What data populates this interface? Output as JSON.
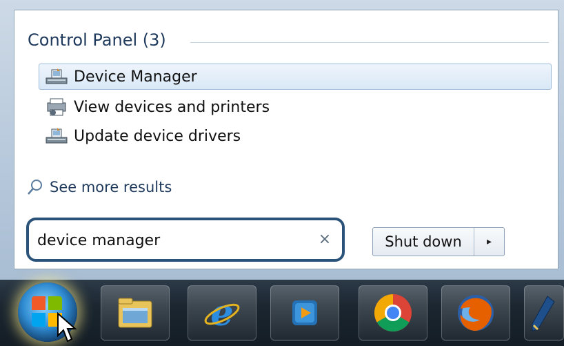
{
  "start_menu": {
    "section_title": "Control Panel (3)",
    "results": [
      {
        "label": "Device Manager",
        "icon": "device-manager-icon",
        "selected": true
      },
      {
        "label": "View devices and printers",
        "icon": "devices-printers-icon",
        "selected": false
      },
      {
        "label": "Update device drivers",
        "icon": "device-manager-icon",
        "selected": false
      }
    ],
    "see_more": "See more results",
    "search": {
      "value": "device manager",
      "clear_glyph": "×"
    },
    "shutdown": {
      "label": "Shut down",
      "arrow_glyph": "▸"
    }
  },
  "taskbar": {
    "items": [
      {
        "name": "start-orb",
        "icon": "windows-start-icon"
      },
      {
        "name": "windows-explorer",
        "icon": "folder-icon"
      },
      {
        "name": "internet-explorer",
        "icon": "internet-explorer-icon"
      },
      {
        "name": "media-player",
        "icon": "media-player-icon"
      },
      {
        "name": "chrome",
        "icon": "chrome-icon"
      },
      {
        "name": "firefox",
        "icon": "firefox-icon"
      },
      {
        "name": "app-partial",
        "icon": "pen-icon"
      }
    ]
  },
  "colors": {
    "accent": "#2b5379",
    "title": "#1e395b",
    "selection": "#d9e8f7"
  }
}
